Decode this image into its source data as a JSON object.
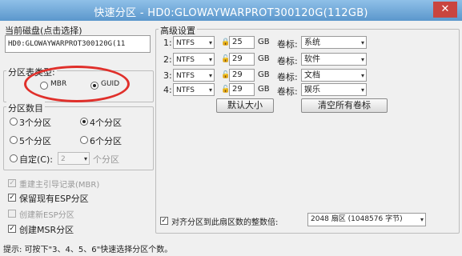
{
  "window": {
    "title": "快速分区 - HD0:GLOWAYWARPROT300120G(112GB)",
    "close": "✕"
  },
  "disk": {
    "label": "当前磁盘(点击选择)",
    "value": "HD0:GLOWAYWARPROT300120G(11"
  },
  "table_type": {
    "label": "分区表类型:",
    "mbr": "MBR",
    "guid": "GUID"
  },
  "partition_count": {
    "label": "分区数目",
    "options": [
      "3个分区",
      "4个分区",
      "5个分区",
      "6个分区"
    ],
    "custom_label": "自定(C):",
    "custom_value": "2",
    "custom_suffix": "个分区"
  },
  "checks": {
    "rebuild_mbr": "重建主引导记录(MBR)",
    "keep_esp": "保留现有ESP分区",
    "create_esp": "创建新ESP分区",
    "create_msr": "创建MSR分区"
  },
  "advanced": {
    "label": "高级设置",
    "rows": [
      {
        "num": "1:",
        "fs": "NTFS",
        "size": "25",
        "unit": "GB",
        "vol_label": "卷标:",
        "name": "系统"
      },
      {
        "num": "2:",
        "fs": "NTFS",
        "size": "29",
        "unit": "GB",
        "vol_label": "卷标:",
        "name": "软件"
      },
      {
        "num": "3:",
        "fs": "NTFS",
        "size": "29",
        "unit": "GB",
        "vol_label": "卷标:",
        "name": "文档"
      },
      {
        "num": "4:",
        "fs": "NTFS",
        "size": "29",
        "unit": "GB",
        "vol_label": "卷标:",
        "name": "娱乐"
      }
    ],
    "default_size_button": "默认大小",
    "clear_labels_button": "清空所有卷标"
  },
  "align": {
    "label": "对齐分区到此扇区数的整数倍:",
    "value": "2048 扇区 (1048576 字节)"
  },
  "hint": "提示: 可按下\"3、4、5、6\"快速选择分区个数。"
}
